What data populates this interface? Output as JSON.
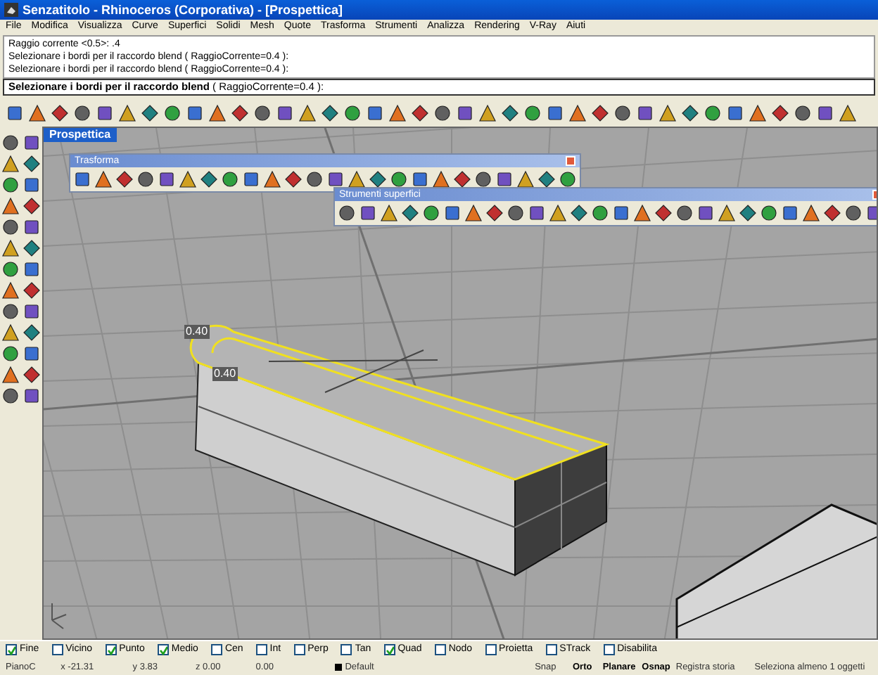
{
  "window": {
    "title": "Senzatitolo - Rhinoceros (Corporativa) - [Prospettica]"
  },
  "menu": [
    "File",
    "Modifica",
    "Visualizza",
    "Curve",
    "Superfici",
    "Solidi",
    "Mesh",
    "Quote",
    "Trasforma",
    "Strumenti",
    "Analizza",
    "Rendering",
    "V-Ray",
    "Aiuti"
  ],
  "command_history": [
    "Raggio corrente <0.5>: .4",
    "Selezionare i bordi per il raccordo blend ( RaggioCorrente=0.4 ):",
    "Selezionare i bordi per il raccordo blend ( RaggioCorrente=0.4 ):"
  ],
  "command_prompt": "**Selezionare i bordi per il raccordo blend** ( RaggioCorrente=0.4 ):",
  "viewport": {
    "tab": "Prospettica",
    "dimension_labels": [
      "0.40",
      "0.40"
    ]
  },
  "floating_toolbars": [
    {
      "title": "Trasforma"
    },
    {
      "title": "Strumenti superfici"
    }
  ],
  "osnaps": [
    {
      "label": "Fine",
      "checked": true
    },
    {
      "label": "Vicino",
      "checked": false
    },
    {
      "label": "Punto",
      "checked": true
    },
    {
      "label": "Medio",
      "checked": true
    },
    {
      "label": "Cen",
      "checked": false
    },
    {
      "label": "Int",
      "checked": false
    },
    {
      "label": "Perp",
      "checked": false
    },
    {
      "label": "Tan",
      "checked": false
    },
    {
      "label": "Quad",
      "checked": true
    },
    {
      "label": "Nodo",
      "checked": false
    },
    {
      "label": "Proietta",
      "checked": false
    },
    {
      "label": "STrack",
      "checked": false
    },
    {
      "label": "Disabilita",
      "checked": false
    }
  ],
  "status_bar": {
    "plane": "PianoC",
    "x": "x -21.31",
    "y": "y 3.83",
    "z": "z 0.00",
    "distance": "0.00",
    "layer": "Default",
    "toggles": [
      {
        "label": "Snap",
        "on": false
      },
      {
        "label": "Orto",
        "on": true
      },
      {
        "label": "Planare",
        "on": true
      },
      {
        "label": "Osnap",
        "on": true
      }
    ],
    "history": "Registra storia",
    "message": "Seleziona almeno 1 oggetti"
  }
}
